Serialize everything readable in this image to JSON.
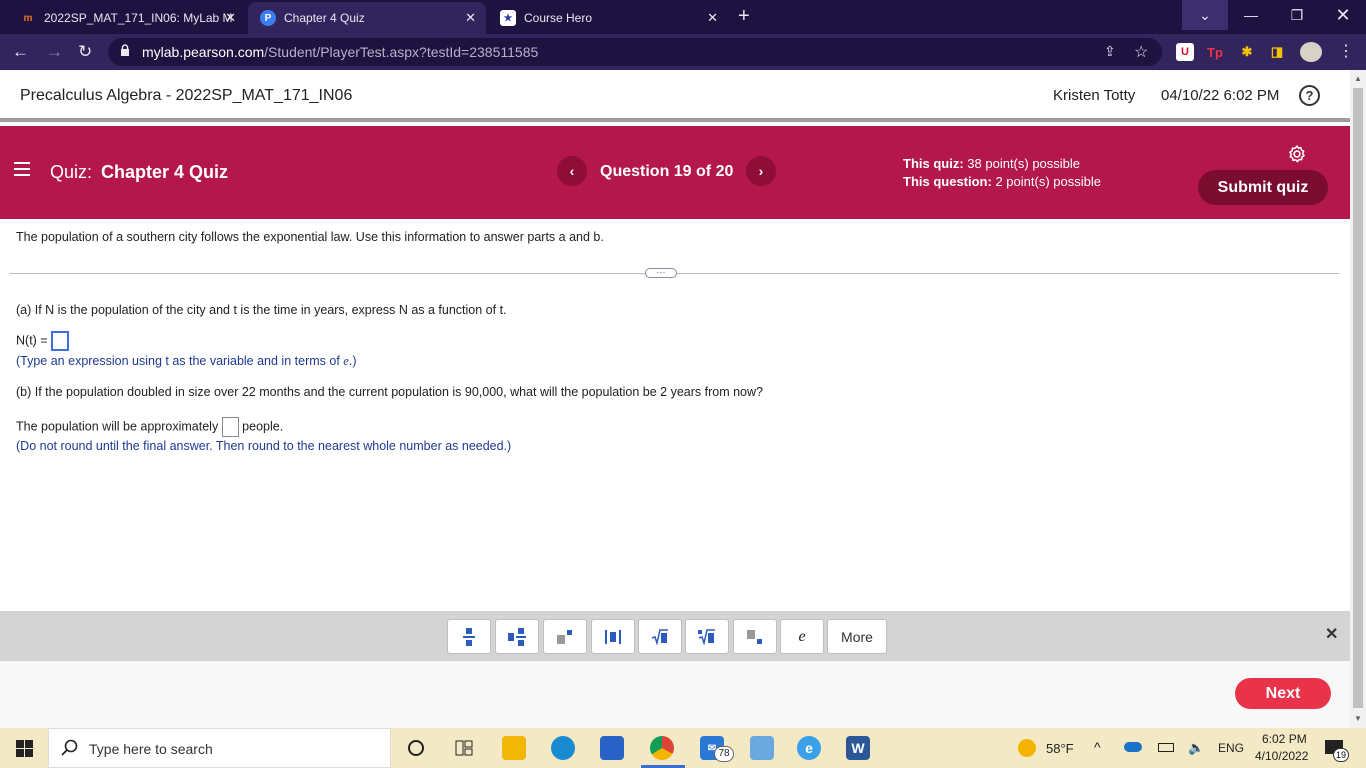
{
  "browser": {
    "tabs": [
      {
        "title": "2022SP_MAT_171_IN06: MyLab M",
        "icon": "mylab-icon",
        "icon_glyph": "m",
        "close": "✕"
      },
      {
        "title": "Chapter 4 Quiz",
        "icon": "pearson-icon",
        "icon_glyph": "P",
        "close": "✕"
      },
      {
        "title": "Course Hero",
        "icon": "star-icon",
        "icon_glyph": "★",
        "close": "✕"
      }
    ],
    "new_tab": "+",
    "url_host": "mylab.pearson.com",
    "url_path": "/Student/PlayerTest.aspx?testId=238511585",
    "extensions": [
      "U",
      "Tp",
      "✱",
      "◨"
    ]
  },
  "course": {
    "title": "Precalculus Algebra - 2022SP_MAT_171_IN06",
    "student": "Kristen Totty",
    "datetime": "04/10/22 6:02 PM",
    "help": "?"
  },
  "quiz": {
    "prefix": "Quiz:",
    "name": "Chapter 4 Quiz",
    "question_label": "Question 19 of 20",
    "prev": "‹",
    "next": "›",
    "quiz_points_label": "This quiz:",
    "quiz_points": "38 point(s) possible",
    "question_points_label": "This question:",
    "question_points": "2 point(s) possible",
    "submit": "Submit quiz"
  },
  "question": {
    "intro": "The population of a southern city follows the exponential law. Use this information to answer parts a and b.",
    "part_a": "(a) If N is the population of the city and t is the time in years, express N as a function of t.",
    "a_label": "N(t) =",
    "a_hint": "(Type an expression using t as the variable and in terms of",
    "a_hint_e": "e",
    "a_hint_end": ".)",
    "part_b": "(b) If the population doubled in size over 22 months and the current population is 90,000, what will the population be 2 years from now?",
    "b_pre": "The population will be approximately",
    "b_post": "people.",
    "b_hint": "(Do not round until the final answer. Then round to the nearest whole number as needed.)"
  },
  "math_palette": {
    "buttons": [
      "fraction-icon",
      "mixed-number-icon",
      "exponent-icon",
      "absolute-value-icon",
      "square-root-icon",
      "nth-root-icon",
      "subscript-icon",
      "e"
    ],
    "more": "More",
    "close": "✕"
  },
  "footer": {
    "next": "Next"
  },
  "taskbar": {
    "search_placeholder": "Type here to search",
    "mail_badge": "78",
    "weather": "58°F",
    "language": "ENG",
    "time": "6:02 PM",
    "date": "4/10/2022",
    "notifications": "19"
  }
}
